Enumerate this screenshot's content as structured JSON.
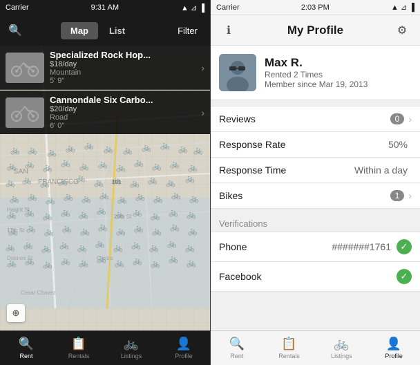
{
  "left": {
    "statusBar": {
      "carrier": "Carrier",
      "time": "9:31 AM",
      "icons": "▲ ☁ ◼"
    },
    "nav": {
      "searchIcon": "🔍",
      "tabs": [
        "Map",
        "List"
      ],
      "activeTab": "Map",
      "filter": "Filter"
    },
    "listings": [
      {
        "name": "Specialized Rock Hop...",
        "price": "$18/day",
        "type": "Mountain",
        "size": "5' 9\""
      },
      {
        "name": "Cannondale Six Carbo...",
        "price": "$20/day",
        "type": "Road",
        "size": "6' 0\""
      }
    ],
    "tabBar": [
      {
        "icon": "🔍",
        "label": "Rent",
        "active": true
      },
      {
        "icon": "🗂",
        "label": "Rentals",
        "active": false
      },
      {
        "icon": "🚲",
        "label": "Listings",
        "active": false
      },
      {
        "icon": "👤",
        "label": "Profile",
        "active": false
      }
    ]
  },
  "right": {
    "statusBar": {
      "carrier": "Carrier",
      "time": "2:03 PM",
      "icons": "▲ ☁ ◼"
    },
    "nav": {
      "infoIcon": "ℹ",
      "title": "My Profile",
      "gearIcon": "⚙"
    },
    "profile": {
      "name": "Max R.",
      "rented": "Rented 2 Times",
      "member": "Member since Mar 19, 2013"
    },
    "stats": [
      {
        "label": "Reviews",
        "badge": "0",
        "hasChevron": true,
        "value": ""
      },
      {
        "label": "Response Rate",
        "badge": "",
        "hasChevron": false,
        "value": "50%"
      },
      {
        "label": "Response Time",
        "badge": "",
        "hasChevron": false,
        "value": "Within a day"
      },
      {
        "label": "Bikes",
        "badge": "1",
        "hasChevron": true,
        "value": ""
      }
    ],
    "verificationsHeader": "Verifications",
    "verifications": [
      {
        "label": "Phone",
        "value": "#######1761",
        "verified": true
      },
      {
        "label": "Facebook",
        "value": "",
        "verified": true
      }
    ],
    "tabBar": [
      {
        "icon": "🔍",
        "label": "Rent",
        "active": false
      },
      {
        "icon": "🗂",
        "label": "Rentals",
        "active": false
      },
      {
        "icon": "🚲",
        "label": "Listings",
        "active": false
      },
      {
        "icon": "👤",
        "label": "Profile",
        "active": true
      }
    ]
  }
}
